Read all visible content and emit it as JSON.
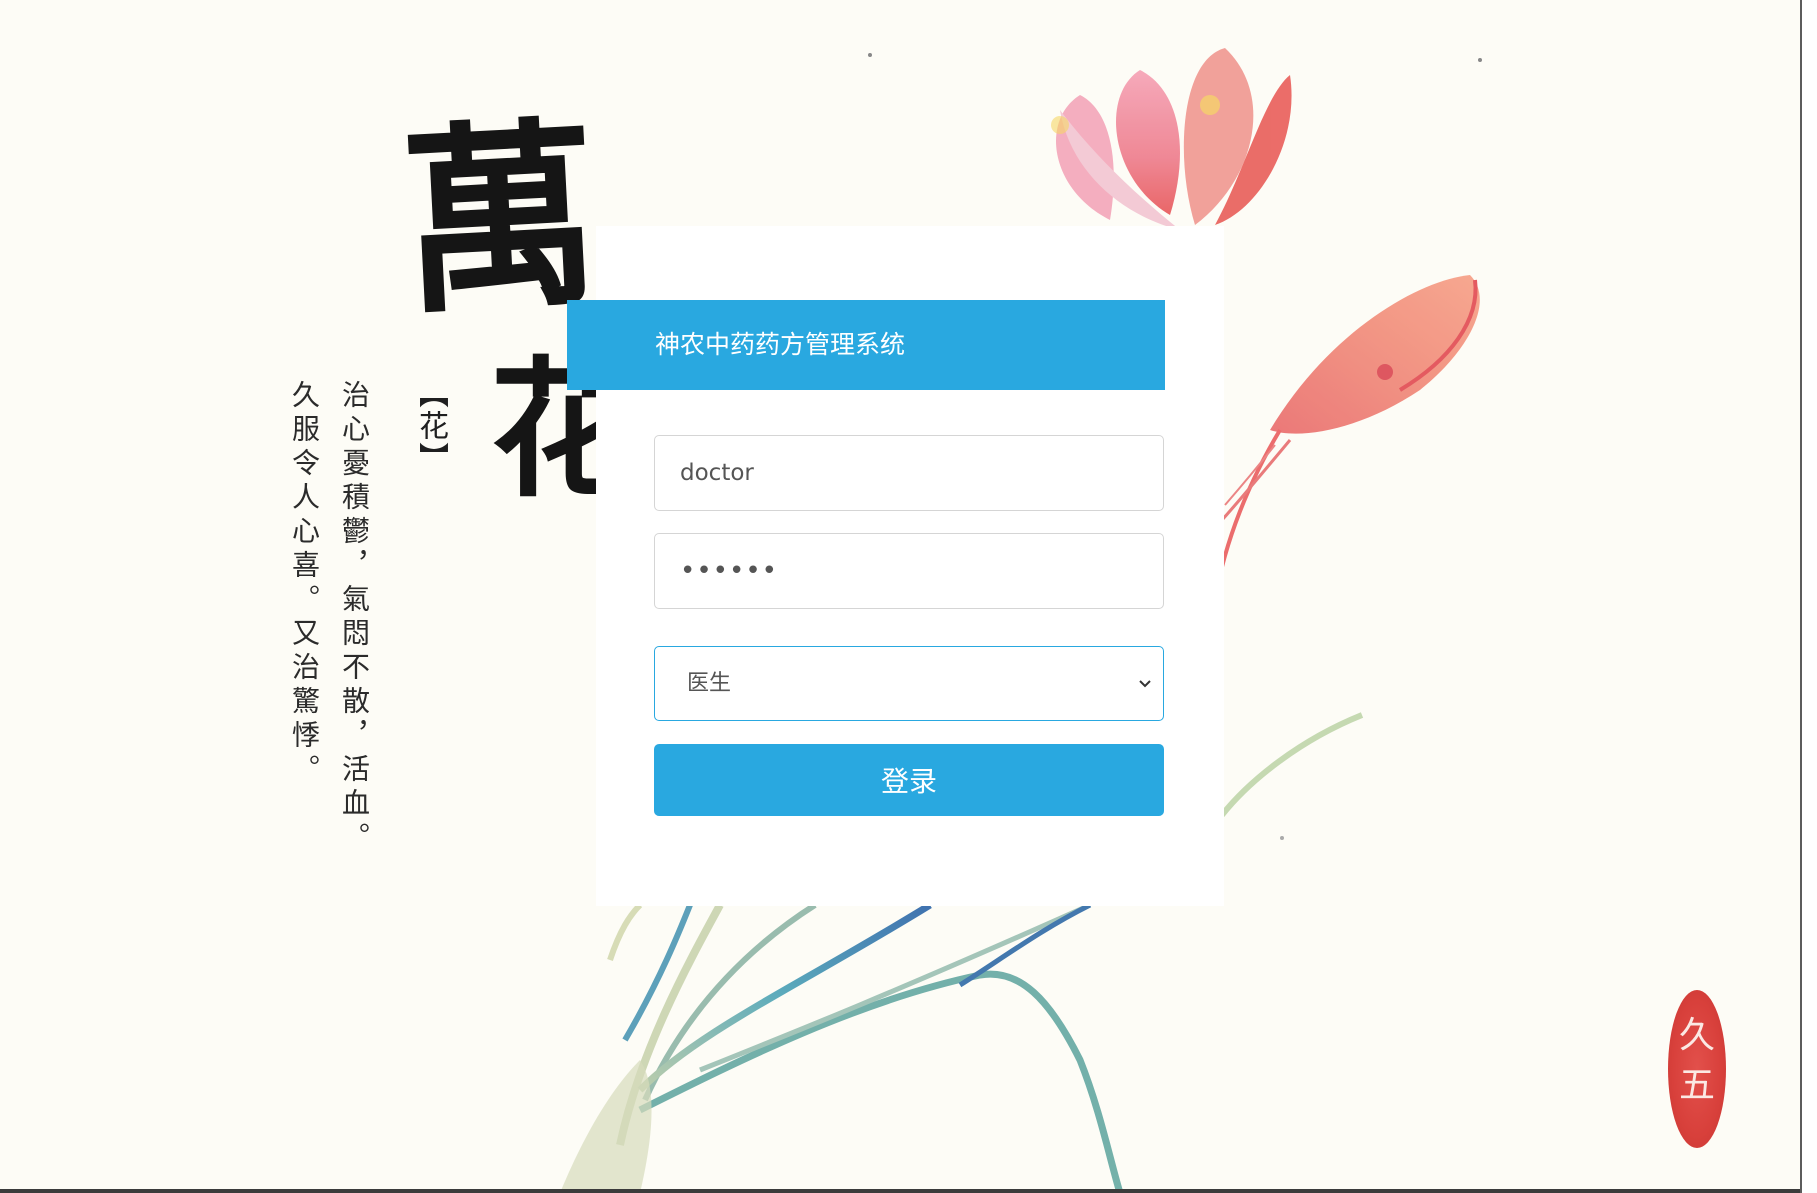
{
  "background": {
    "calligraphy_large": [
      "萬",
      "花"
    ],
    "calligraphy_tag": "【花】",
    "verse_lines": [
      "治心憂積鬱，氣悶不散，活血。",
      "久服令人心喜。又治驚悸。"
    ],
    "seal_text": [
      "久",
      "五"
    ]
  },
  "login": {
    "title": "神农中药药方管理系统",
    "username_value": "doctor",
    "password_value": "••••••",
    "role_selected": "医生",
    "submit_label": "登录"
  },
  "colors": {
    "accent": "#29a8e0",
    "page_bg": "#fdfcf6",
    "seal_red": "#d8403b"
  }
}
